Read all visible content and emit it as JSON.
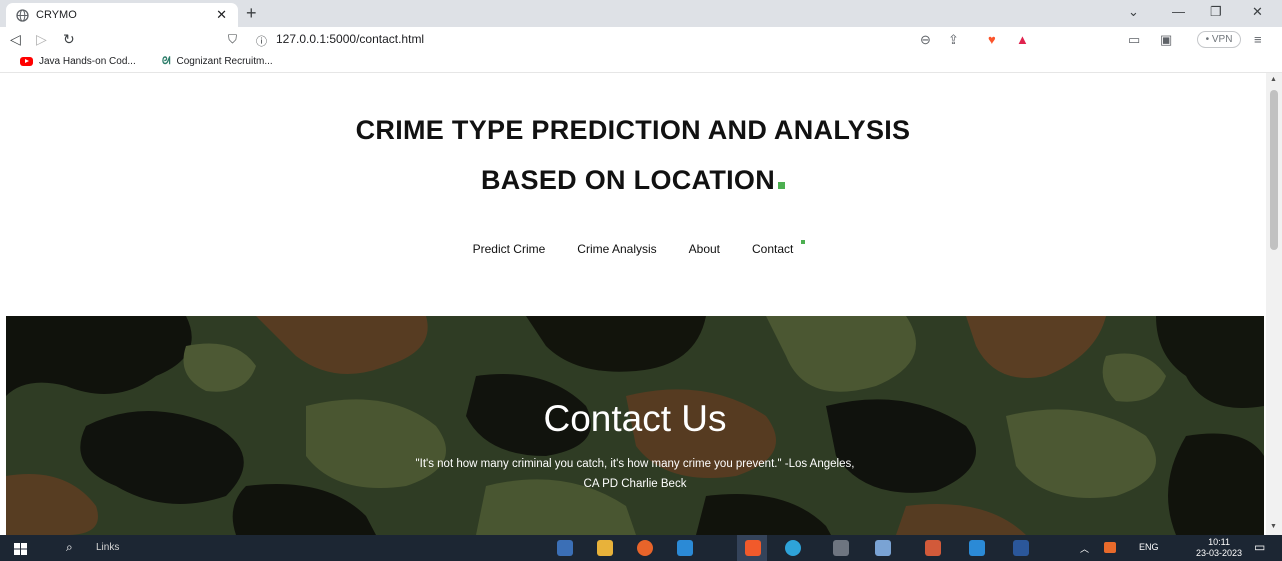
{
  "browser": {
    "tab_title": "CRYMO",
    "url": "127.0.0.1:5000/contact.html",
    "vpn_label": "• VPN",
    "bookmarks": [
      {
        "label": "Java Hands-on Cod...",
        "icon": "youtube-icon"
      },
      {
        "label": "Cognizant Recruitm...",
        "icon": "cognizant-icon"
      }
    ]
  },
  "page": {
    "title_line1": "CRIME TYPE PREDICTION AND ANALYSIS",
    "title_line2": "BASED ON LOCATION",
    "nav": [
      "Predict Crime",
      "Crime Analysis",
      "About",
      "Contact"
    ],
    "accent_color": "#4caf50",
    "hero": {
      "title": "Contact Us",
      "quote_line1": "\"It's not how many criminal you catch, it's how many crime you prevent.\" -Los Angeles,",
      "quote_line2": "CA PD Charlie Beck"
    }
  },
  "taskbar": {
    "search_label": "Links",
    "lang": "ENG",
    "time": "10:11",
    "date": "23-03-2023"
  }
}
